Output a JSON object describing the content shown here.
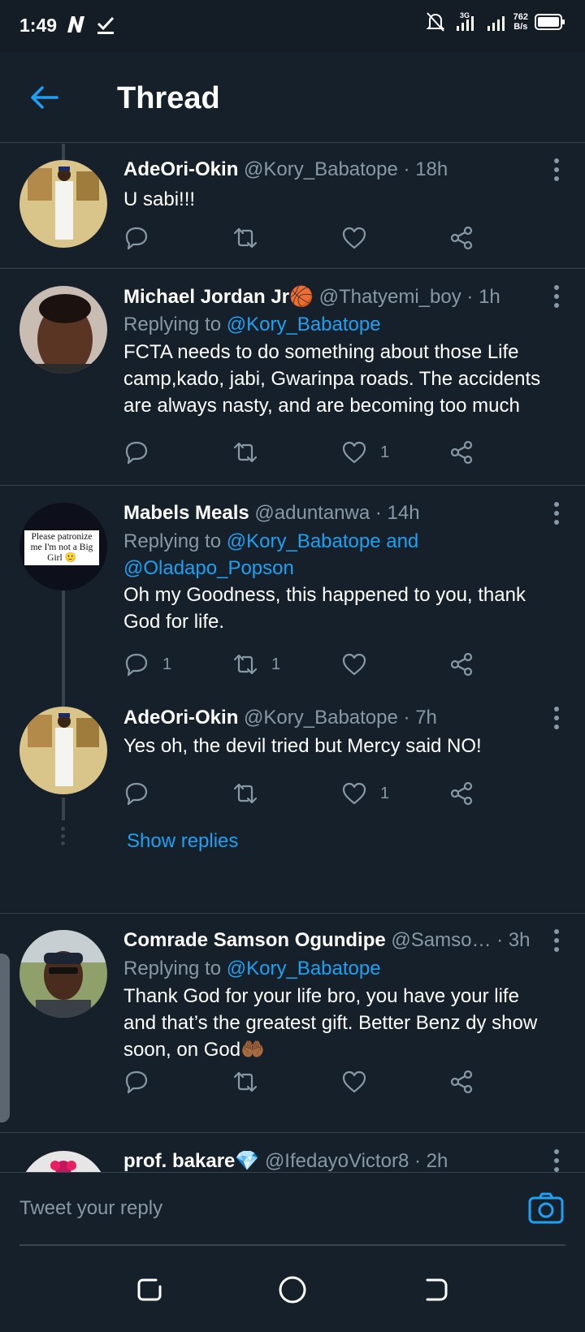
{
  "status": {
    "time": "1:49",
    "netspeed_value": "762",
    "netspeed_unit": "B/s",
    "network": "3G"
  },
  "header": {
    "title": "Thread"
  },
  "tweets": [
    {
      "name": "AdeOri-Okin",
      "handle": "@Kory_Babatope",
      "time": "18h",
      "body": "U sabi!!!",
      "reply_count": "",
      "retweet_count": "",
      "like_count": ""
    },
    {
      "name": "Michael Jordan Jr🏀",
      "handle": "@Thatyemi_boy",
      "time": "1h",
      "replying_prefix": "Replying to ",
      "replying_to": "@Kory_Babatope",
      "body": "FCTA needs to do something about those Life camp,kado, jabi, Gwarinpa roads. The accidents are always nasty, and are becoming too much",
      "reply_count": "",
      "retweet_count": "",
      "like_count": "1"
    },
    {
      "name": "Mabels Meals",
      "handle": "@aduntanwa",
      "time": "14h",
      "replying_prefix": "Replying to ",
      "replying_to": "@Kory_Babatope and @Oladapo_Popson",
      "avatar_text": "Please patronize me I'm not a Big Girl 🙂",
      "body": "Oh my Goodness, this happened to you, thank God for life.",
      "reply_count": "1",
      "retweet_count": "1",
      "like_count": ""
    },
    {
      "name": "AdeOri-Okin",
      "handle": "@Kory_Babatope",
      "time": "7h",
      "body": "Yes oh, the devil tried but Mercy said NO!",
      "reply_count": "",
      "retweet_count": "",
      "like_count": "1",
      "show_replies": "Show replies"
    },
    {
      "name": "Comrade Samson Ogundipe",
      "handle": "@Samso…",
      "time": "3h",
      "replying_prefix": "Replying to ",
      "replying_to": "@Kory_Babatope",
      "body": "Thank God for your life bro, you have your life and that’s the greatest gift. Better Benz dy show soon, on God🤲🏾",
      "reply_count": "",
      "retweet_count": "",
      "like_count": ""
    },
    {
      "name": "prof. bakare💎",
      "handle": "@IfedayoVictor8",
      "time": "2h"
    }
  ],
  "reply_bar": {
    "placeholder": "Tweet your reply"
  },
  "colors": {
    "background": "#15202b",
    "accent": "#1da1f2",
    "secondary_text": "#8899a6",
    "divider": "#38444d"
  }
}
